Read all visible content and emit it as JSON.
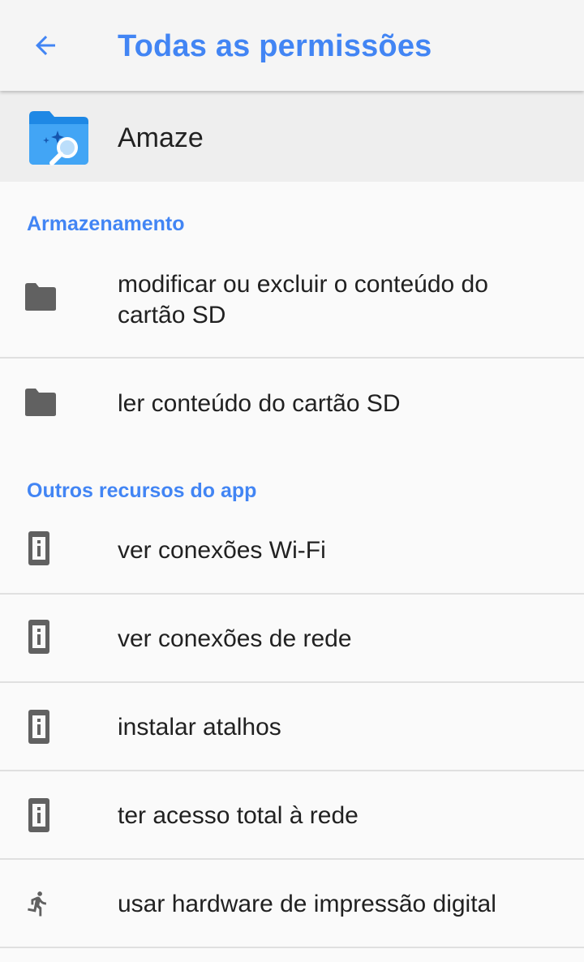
{
  "appbar": {
    "title": "Todas as permissões",
    "back_icon": "arrow-back-icon"
  },
  "app": {
    "name": "Amaze",
    "icon": "amaze-folder-icon"
  },
  "sections": [
    {
      "title": "Armazenamento",
      "items": [
        {
          "label": "modificar ou excluir o conteúdo do cartão SD",
          "icon": "folder-icon"
        },
        {
          "label": "ler conteúdo do cartão SD",
          "icon": "folder-icon"
        }
      ]
    },
    {
      "title": "Outros recursos do app",
      "items": [
        {
          "label": "ver conexões Wi-Fi",
          "icon": "info-device-icon"
        },
        {
          "label": "ver conexões de rede",
          "icon": "info-device-icon"
        },
        {
          "label": "instalar atalhos",
          "icon": "info-device-icon"
        },
        {
          "label": "ter acesso total à rede",
          "icon": "info-device-icon"
        },
        {
          "label": "usar hardware de impressão digital",
          "icon": "running-person-icon"
        }
      ]
    }
  ],
  "colors": {
    "accent": "#4285f4",
    "icon_gray": "#616161",
    "text": "#212121",
    "divider": "#e0e0e0"
  }
}
